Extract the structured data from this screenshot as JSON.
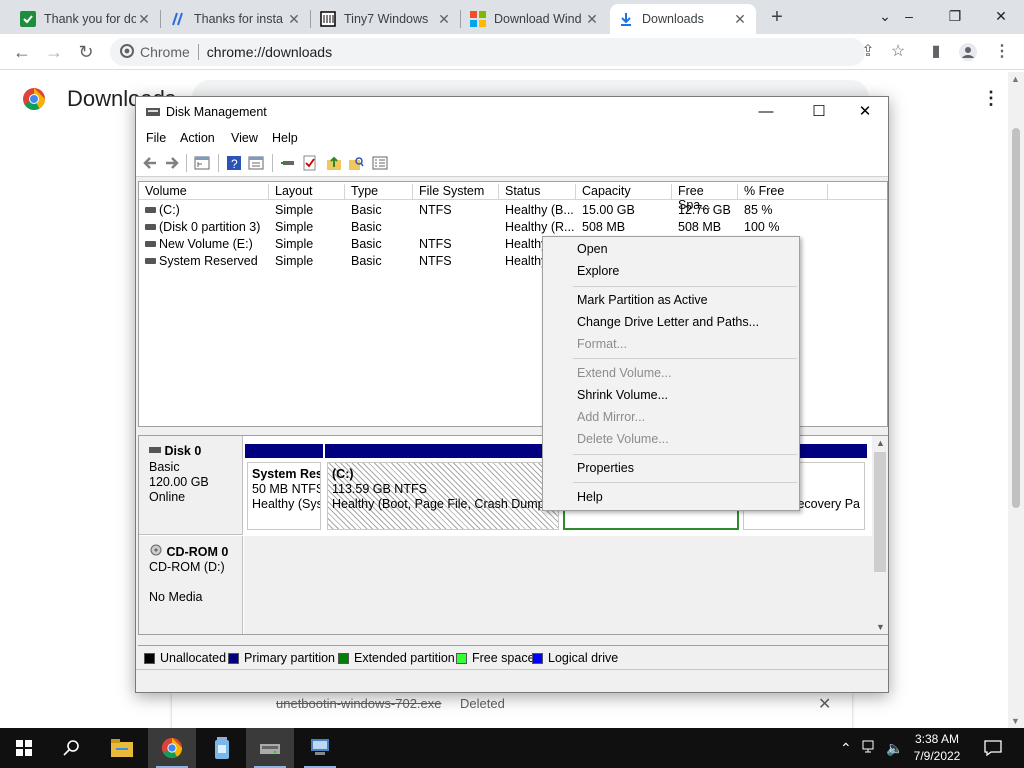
{
  "browser": {
    "tabs": [
      {
        "title": "Thank you for do"
      },
      {
        "title": "Thanks for insta"
      },
      {
        "title": "Tiny7 Windows"
      },
      {
        "title": "Download Wind"
      },
      {
        "title": "Downloads"
      }
    ],
    "site_label": "Chrome",
    "url": "chrome://downloads"
  },
  "downloads_page": {
    "title": "Downloads",
    "item": {
      "filename": "unetbootin-windows-702.exe",
      "status": "Deleted"
    }
  },
  "disk_management": {
    "window_title": "Disk Management",
    "menu": [
      "File",
      "Action",
      "View",
      "Help"
    ],
    "columns": [
      "Volume",
      "Layout",
      "Type",
      "File System",
      "Status",
      "Capacity",
      "Free Spa...",
      "% Free"
    ],
    "volumes": [
      {
        "volume": "(C:)",
        "layout": "Simple",
        "type": "Basic",
        "fs": "NTFS",
        "status": "Healthy (B...",
        "capacity": "15.00 GB",
        "free": "12.76 GB",
        "pct": "85 %"
      },
      {
        "volume": "(Disk 0 partition 3)",
        "layout": "Simple",
        "type": "Basic",
        "fs": "",
        "status": "Healthy (R...",
        "capacity": "508 MB",
        "free": "508 MB",
        "pct": "100 %"
      },
      {
        "volume": "New Volume (E:)",
        "layout": "Simple",
        "type": "Basic",
        "fs": "NTFS",
        "status": "Healthy",
        "capacity": "",
        "free": "",
        "pct": ""
      },
      {
        "volume": "System Reserved",
        "layout": "Simple",
        "type": "Basic",
        "fs": "NTFS",
        "status": "Healthy",
        "capacity": "",
        "free": "",
        "pct": ""
      }
    ],
    "disk0": {
      "name": "Disk 0",
      "type": "Basic",
      "size": "120.00 GB",
      "state": "Online",
      "partitions": [
        {
          "name": "System Res",
          "size": "50 MB NTFS",
          "status": "Healthy (Sys"
        },
        {
          "name": "(C:)",
          "size": "113.59 GB NTFS",
          "status": "Healthy (Boot, Page File, Crash Dump, P"
        },
        {
          "name": "",
          "size": "",
          "status": ""
        },
        {
          "name": "",
          "size": "",
          "status": "ecovery Pa"
        }
      ]
    },
    "cdrom0": {
      "name": "CD-ROM 0",
      "drive": "CD-ROM (D:)",
      "media": "No Media"
    },
    "legend": [
      {
        "label": "Unallocated",
        "color": "#000000"
      },
      {
        "label": "Primary partition",
        "color": "#000080"
      },
      {
        "label": "Extended partition",
        "color": "#008000"
      },
      {
        "label": "Free space",
        "color": "#33ff33"
      },
      {
        "label": "Logical drive",
        "color": "#0000ff"
      }
    ]
  },
  "context_menu": {
    "items": [
      {
        "label": "Open",
        "enabled": true
      },
      {
        "label": "Explore",
        "enabled": true
      },
      {
        "label": "Mark Partition as Active",
        "enabled": true
      },
      {
        "label": "Change Drive Letter and Paths...",
        "enabled": true
      },
      {
        "label": "Format...",
        "enabled": false
      },
      {
        "label": "Extend Volume...",
        "enabled": false
      },
      {
        "label": "Shrink Volume...",
        "enabled": true
      },
      {
        "label": "Add Mirror...",
        "enabled": false
      },
      {
        "label": "Delete Volume...",
        "enabled": false
      },
      {
        "label": "Properties",
        "enabled": true
      },
      {
        "label": "Help",
        "enabled": true
      }
    ]
  },
  "taskbar": {
    "time": "3:38 AM",
    "date": "7/9/2022"
  }
}
